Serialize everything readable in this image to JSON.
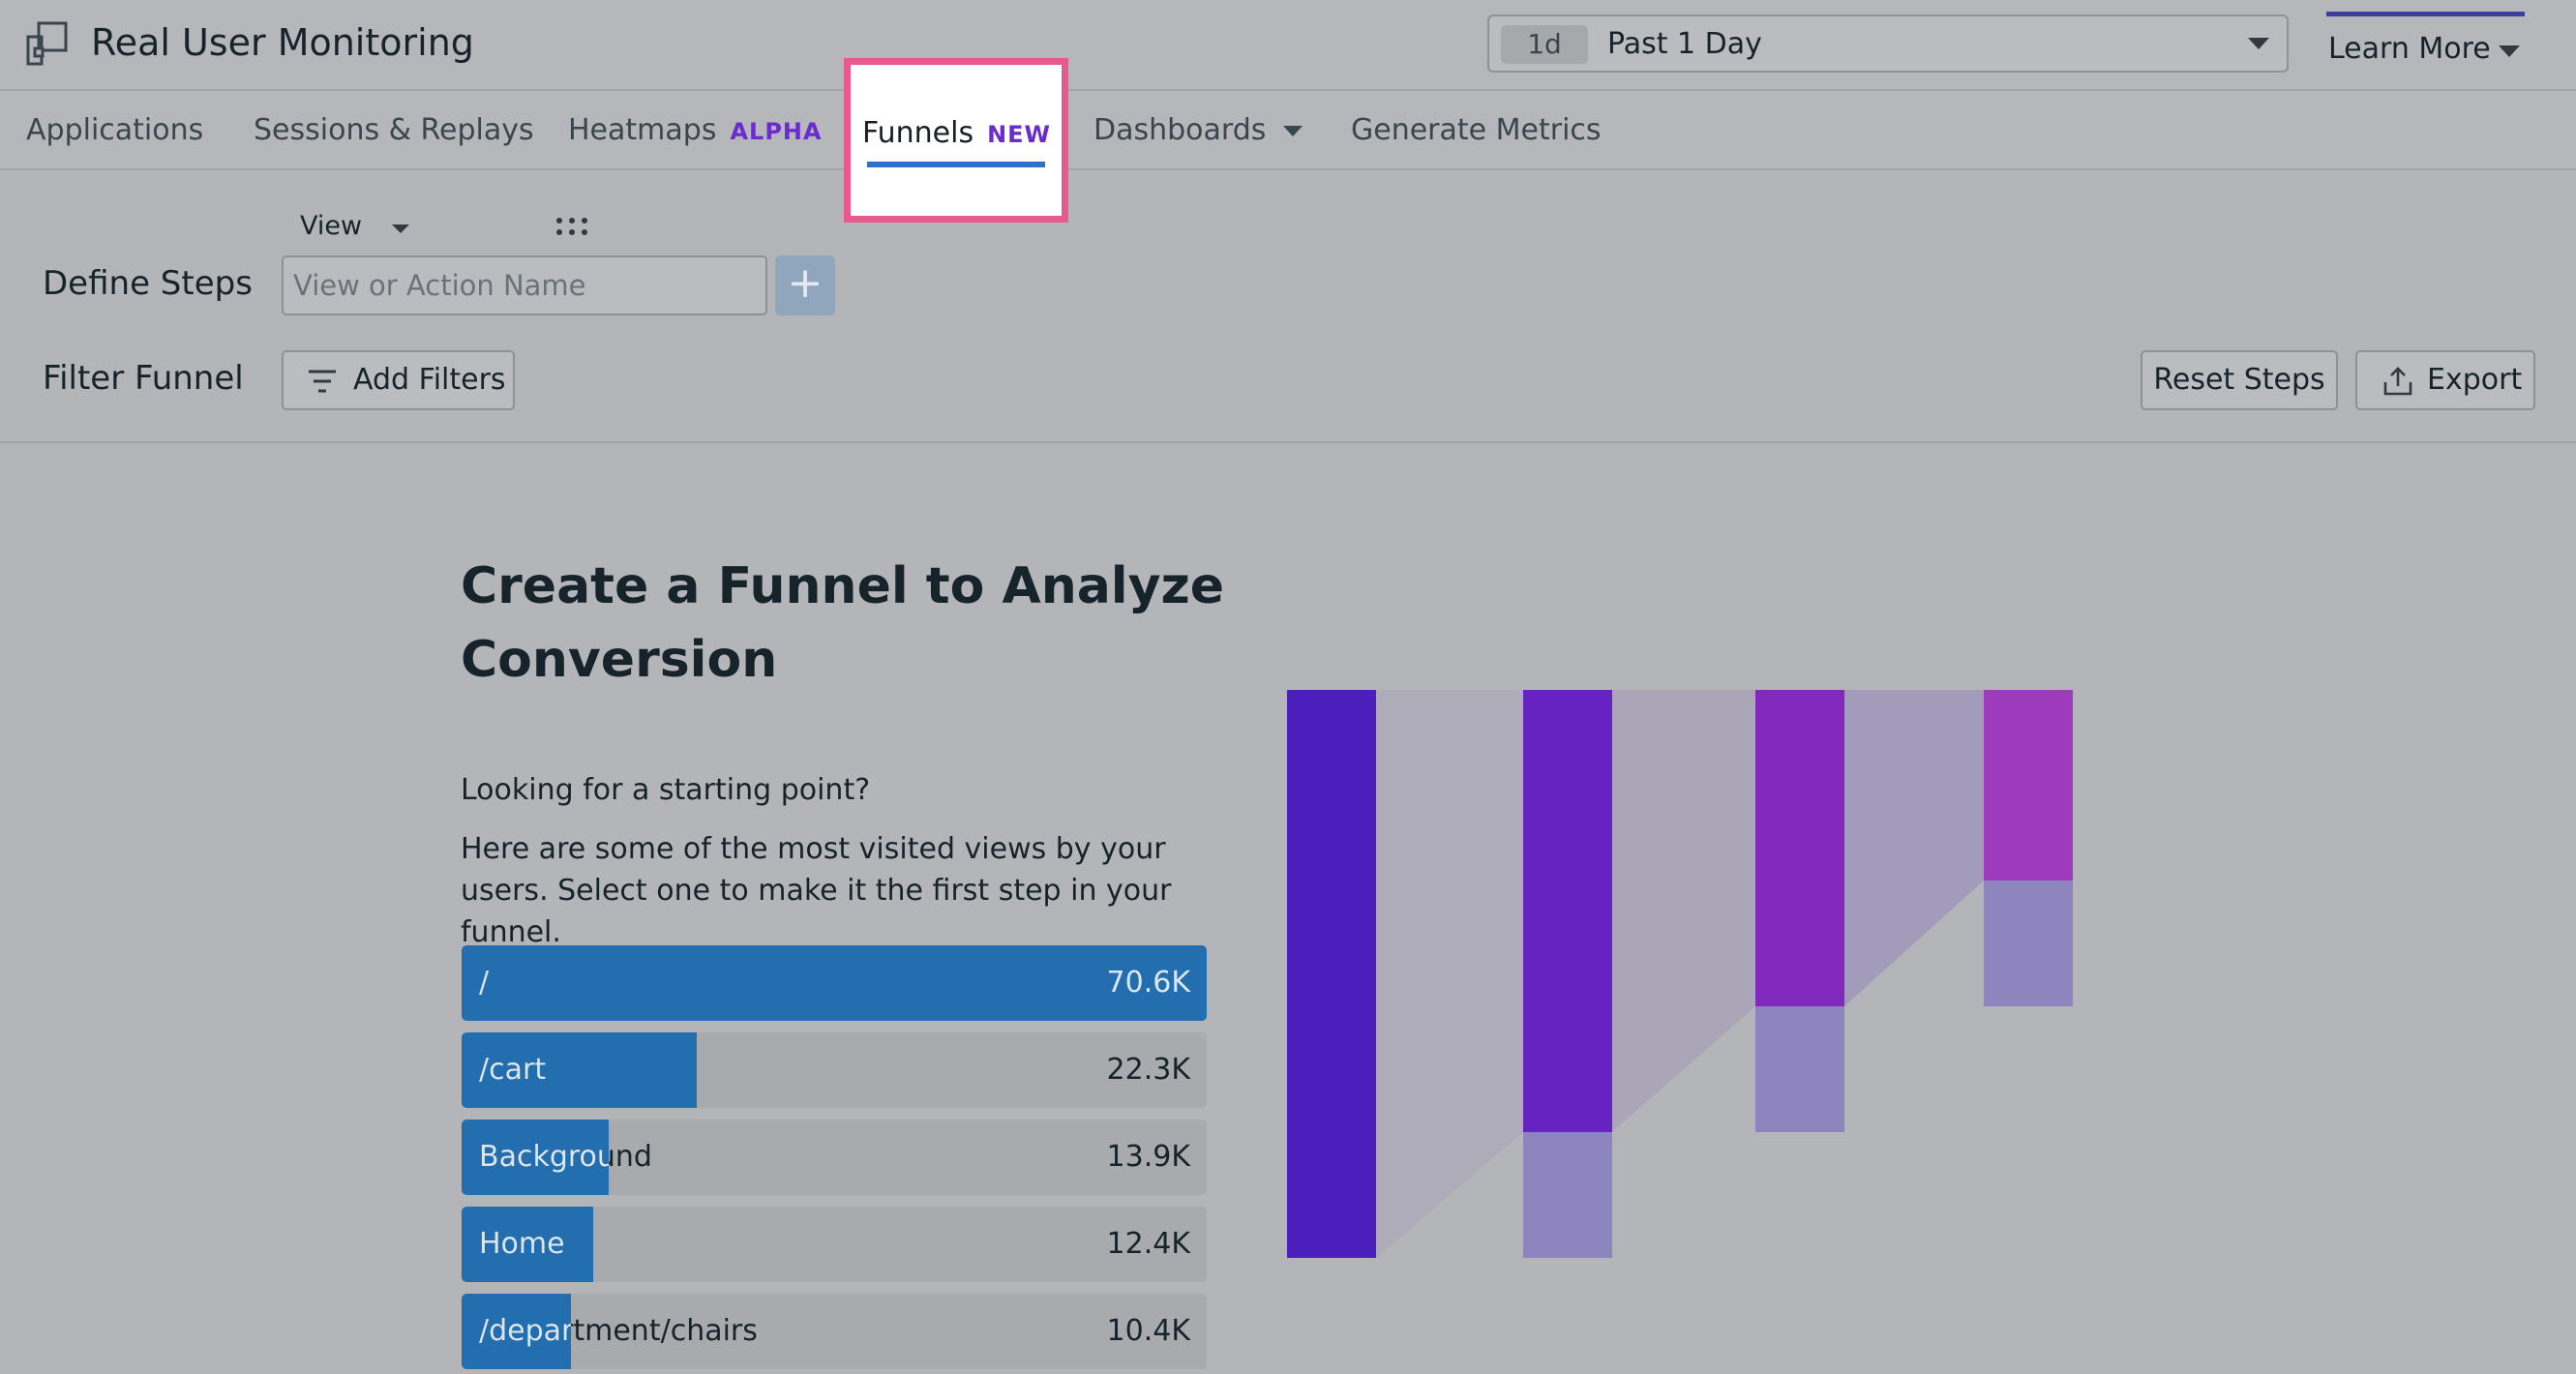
{
  "header": {
    "title": "Real User Monitoring",
    "time_badge": "1d",
    "time_label": "Past 1 Day",
    "learn_more": "Learn More"
  },
  "tabs": [
    {
      "label": "Applications"
    },
    {
      "label": "Sessions & Replays"
    },
    {
      "label": "Heatmaps",
      "badge": "ALPHA"
    },
    {
      "label": "Funnels",
      "badge": "NEW",
      "active": true
    },
    {
      "label": "Dashboards"
    },
    {
      "label": "Generate Metrics"
    }
  ],
  "steps": {
    "type_label": "View",
    "define_label": "Define Steps",
    "input_placeholder": "View or Action Name",
    "add_button": "+",
    "filter_label": "Filter Funnel",
    "add_filters": "Add Filters",
    "reset_steps": "Reset Steps",
    "export": "Export"
  },
  "empty_state": {
    "title": "Create a Funnel to Analyze Conversion",
    "hint1": "Looking for a starting point?",
    "hint2": "Here are some of the most visited views by your users. Select one to make it the first step in your funnel.",
    "views": [
      {
        "name": "/",
        "count": "70.6K",
        "fraction": 1.0
      },
      {
        "name": "/cart",
        "count": "22.3K",
        "fraction": 0.315
      },
      {
        "name": "Background",
        "count": "13.9K",
        "fraction": 0.197
      },
      {
        "name": "Home",
        "count": "12.4K",
        "fraction": 0.176
      },
      {
        "name": "/department/chairs",
        "count": "10.4K",
        "fraction": 0.147
      }
    ]
  },
  "colors": {
    "accent_blue": "#226eaf",
    "highlight_pink": "#e95a8c",
    "badge_purple": "#6a2bd0",
    "funnel_bars": [
      "#4a1fbc",
      "#6622c2",
      "#8229bd",
      "#9e3bbd"
    ]
  }
}
